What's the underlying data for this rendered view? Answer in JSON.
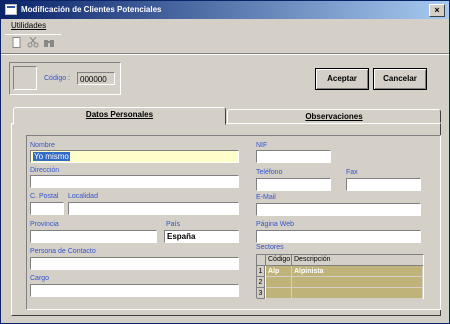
{
  "window": {
    "title": "Modificación de Clientes Potenciales",
    "close_glyph": "×"
  },
  "menu": {
    "items": [
      "Utilidades"
    ]
  },
  "toolbar": {
    "icons": [
      "new-document-icon",
      "cut-icon",
      "binoculars-icon"
    ]
  },
  "header": {
    "codigo_label": "Código :",
    "codigo_value": "000000",
    "accept_label": "Aceptar",
    "cancel_label": "Cancelar"
  },
  "tabs": [
    {
      "label": "Datos Personales",
      "active": true
    },
    {
      "label": "Observaciones",
      "active": false
    }
  ],
  "form": {
    "nombre_label": "Nombre",
    "nombre_value": "Yo mismo",
    "direccion_label": "Dirección",
    "direccion_value": "",
    "cpostal_label": "C. Postal",
    "cpostal_value": "",
    "localidad_label": "Localidad",
    "localidad_value": "",
    "provincia_label": "Provincia",
    "provincia_value": "",
    "pais_label": "País",
    "pais_value": "España",
    "contacto_label": "Persona de Contacto",
    "contacto_value": "",
    "cargo_label": "Cargo",
    "cargo_value": "",
    "nif_label": "NIF",
    "nif_value": "",
    "telefono_label": "Teléfono",
    "telefono_value": "",
    "fax_label": "Fax",
    "fax_value": "",
    "email_label": "E-Mail",
    "email_value": "",
    "web_label": "Página Web",
    "web_value": "",
    "sectores_label": "Sectores"
  },
  "sectores": {
    "columns": [
      "Código",
      "Descripción"
    ],
    "rows": [
      {
        "num": "1",
        "codigo": "Alp",
        "descripcion": "Alpinista"
      },
      {
        "num": "2",
        "codigo": "",
        "descripcion": ""
      },
      {
        "num": "3",
        "codigo": "",
        "descripcion": ""
      }
    ]
  },
  "colors": {
    "title_bar": "#0a246a",
    "label": "#3355cc",
    "grid_cell": "#bfb37a",
    "highlight_field": "#ffffcc",
    "selection": "#316ac5"
  }
}
